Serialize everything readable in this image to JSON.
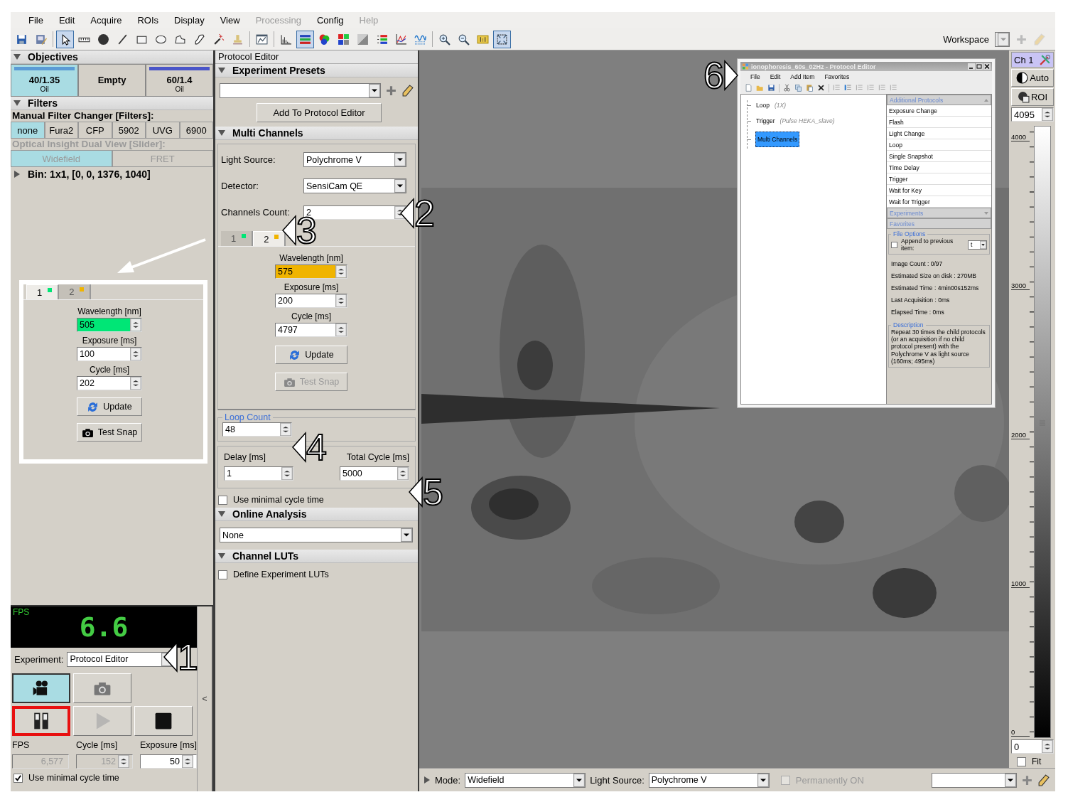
{
  "menu": [
    {
      "label": "File",
      "disabled": false
    },
    {
      "label": "Edit",
      "disabled": false
    },
    {
      "label": "Acquire",
      "disabled": false
    },
    {
      "label": "ROIs",
      "disabled": false
    },
    {
      "label": "Display",
      "disabled": false
    },
    {
      "label": "View",
      "disabled": false
    },
    {
      "label": "Processing",
      "disabled": true
    },
    {
      "label": "Config",
      "disabled": false
    },
    {
      "label": "Help",
      "disabled": true
    }
  ],
  "toolbar": {
    "tools": [
      {
        "kind": "save",
        "selected": false
      },
      {
        "kind": "save-image",
        "selected": false
      },
      {
        "kind": "pointer",
        "selected": true
      },
      {
        "kind": "ruler",
        "selected": false
      },
      {
        "kind": "dot",
        "selected": false
      },
      {
        "kind": "line",
        "selected": false
      },
      {
        "kind": "rectangle",
        "selected": false
      },
      {
        "kind": "ellipse",
        "selected": false
      },
      {
        "kind": "polygon",
        "selected": false
      },
      {
        "kind": "pen",
        "selected": false
      },
      {
        "kind": "wand",
        "selected": false
      },
      {
        "kind": "stamp",
        "selected": false
      },
      {
        "kind": "chart-window",
        "selected": false
      },
      {
        "kind": "histogram",
        "selected": false
      },
      {
        "kind": "color-bars",
        "selected": true
      },
      {
        "kind": "color-circles",
        "selected": false
      },
      {
        "kind": "color-grid",
        "selected": false
      },
      {
        "kind": "gradient",
        "selected": false
      },
      {
        "kind": "color-list",
        "selected": false
      },
      {
        "kind": "line-graph",
        "selected": false
      },
      {
        "kind": "wave",
        "selected": false
      },
      {
        "kind": "zoom-in",
        "selected": false
      },
      {
        "kind": "zoom-out",
        "selected": false
      },
      {
        "kind": "actual-size",
        "selected": false
      },
      {
        "kind": "fit-frame",
        "selected": true
      }
    ],
    "workspace_label": "Workspace"
  },
  "objectives": {
    "title": "Objectives",
    "expanded": true,
    "items": [
      {
        "label": "40/1.35",
        "sub": "Oil",
        "color": "#5b9bd5",
        "selected": true
      },
      {
        "label": "Empty",
        "selected": false
      },
      {
        "label": "60/1.4",
        "sub": "Oil",
        "color": "#4a55c8",
        "selected": false
      }
    ]
  },
  "filters": {
    "title": "Filters",
    "expanded": true,
    "changer_label": "Manual Filter Changer [Filters]:",
    "changer_items": [
      {
        "label": "none",
        "selected": true
      },
      {
        "label": "Fura2",
        "selected": false
      },
      {
        "label": "CFP",
        "selected": false
      },
      {
        "label": "5902",
        "selected": false
      },
      {
        "label": "UVG",
        "selected": false
      },
      {
        "label": "6900",
        "selected": false
      }
    ],
    "slider_label": "Optical Insight Dual View [Slider]:",
    "slider_disabled": true,
    "slider_items": [
      {
        "label": "Widefield",
        "selected": true
      },
      {
        "label": "FRET",
        "selected": false
      }
    ]
  },
  "bin": {
    "label": "Bin: 1x1, [0, 0, 1376, 1040]",
    "expanded": false
  },
  "channel_zoom": {
    "tabs": [
      {
        "label": "1",
        "color": "#00e676",
        "selected": true
      },
      {
        "label": "2",
        "color": "#f0b400",
        "selected": false
      }
    ],
    "fields": [
      {
        "kind": "wavelength",
        "label": "Wavelength [nm]",
        "value": "505"
      },
      {
        "kind": "number",
        "label": "Exposure [ms]",
        "value": "100"
      },
      {
        "kind": "number",
        "label": "Cycle [ms]",
        "value": "202"
      }
    ],
    "buttons": [
      {
        "kind": "update",
        "label": "Update",
        "disabled": false
      },
      {
        "kind": "snap",
        "label": "Test Snap",
        "disabled": false
      }
    ]
  },
  "acquisition": {
    "fps_label": "FPS",
    "fps_value": "6.6",
    "experiment_label": "Experiment:",
    "experiment_value": "Protocol Editor",
    "buttons": [
      {
        "kind": "video",
        "selected": true,
        "highlighted": false,
        "disabled": false
      },
      {
        "kind": "camera",
        "selected": false,
        "highlighted": false,
        "disabled": false
      },
      {
        "kind": "pause",
        "selected": false,
        "highlighted": true,
        "disabled": false
      },
      {
        "kind": "play",
        "selected": false,
        "highlighted": false,
        "disabled": true
      },
      {
        "kind": "stop",
        "selected": false,
        "highlighted": false,
        "disabled": false
      }
    ],
    "stats": [
      {
        "kind": "plain",
        "label": "FPS",
        "value": "6,577",
        "disabled": true
      },
      {
        "kind": "spin",
        "label": "Cycle [ms]",
        "value": "152",
        "disabled": true
      },
      {
        "kind": "spin",
        "label": "Exposure [ms]",
        "value": "50",
        "disabled": false
      }
    ],
    "minimal_cycle": {
      "label": "Use minimal cycle time",
      "checked": true
    },
    "collapse": "<"
  },
  "protocol_editor": {
    "title": "Protocol Editor",
    "presets": {
      "title": "Experiment Presets",
      "expanded": true,
      "add_button": "Add To Protocol Editor"
    },
    "multi_channels": {
      "title": "Multi Channels",
      "expanded": true,
      "light_source_label": "Light Source:",
      "light_source": "Polychrome V",
      "detector_label": "Detector:",
      "detector": "SensiCam QE",
      "count_label": "Channels Count:",
      "count": "2",
      "tabs": [
        {
          "label": "1",
          "color": "#00e676",
          "selected": false
        },
        {
          "label": "2",
          "color": "#f0b400",
          "selected": true
        }
      ],
      "fields": [
        {
          "kind": "wavelength",
          "label": "Wavelength [nm]",
          "value": "575"
        },
        {
          "kind": "number",
          "label": "Exposure [ms]",
          "value": "200"
        },
        {
          "kind": "number",
          "label": "Cycle [ms]",
          "value": "4797"
        }
      ],
      "buttons": [
        {
          "kind": "update",
          "label": "Update",
          "disabled": false
        },
        {
          "kind": "snap",
          "label": "Test Snap",
          "disabled": true
        }
      ]
    },
    "loop": {
      "title": "Loop Count",
      "value": "48"
    },
    "delay_label": "Delay [ms]",
    "delay": "1",
    "total_label": "Total Cycle [ms]",
    "total": "5000",
    "minimal_cycle": {
      "label": "Use minimal cycle time",
      "checked": false
    },
    "analysis": {
      "title": "Online Analysis",
      "expanded": true,
      "value": "None"
    },
    "luts": {
      "title": "Channel LUTs",
      "expanded": true,
      "checkbox": {
        "label": "Define Experiment LUTs",
        "checked": false
      }
    }
  },
  "inset_window": {
    "title": "ionophoresis_60s_02Hz - Protocol Editor",
    "menu": [
      "File",
      "Edit",
      "Add Item",
      "Favorites"
    ],
    "tools": [
      {
        "kind": "new-file"
      },
      {
        "kind": "folder"
      },
      {
        "kind": "save"
      },
      {
        "kind": "scissors"
      },
      {
        "kind": "copy"
      },
      {
        "kind": "paste"
      },
      {
        "kind": "delete"
      },
      {
        "kind": "list-lines"
      },
      {
        "kind": "list-marker"
      },
      {
        "kind": "list-lines"
      },
      {
        "kind": "list-lines"
      },
      {
        "kind": "list-lines"
      },
      {
        "kind": "list-lines"
      }
    ],
    "tree": [
      {
        "label": "Loop",
        "note": "(1X)",
        "selected": false
      },
      {
        "label": "Trigger",
        "note": "(Pulse HEKA_slave)",
        "selected": false
      },
      {
        "label": "Multi Channels",
        "selected": true
      }
    ],
    "additional_title": "Additional Protocols",
    "protocols": [
      "Exposure Change",
      "Flash",
      "Light Change",
      "Loop",
      "Single Snapshot",
      "Time Delay",
      "Trigger",
      "Wait for Key",
      "Wait for Trigger"
    ],
    "experiments_title": "Experiments",
    "favorites_title": "Favorites",
    "file_options": {
      "title": "File Options",
      "label": "Append to previous item:",
      "checked": false,
      "value": "t"
    },
    "stats": [
      "Image Count : 0/97",
      "Estimated Size on disk : 270MB",
      "Estimated Time : 4min00s152ms",
      "Last Acquisition : 0ms",
      "Elapsed Time : 0ms"
    ],
    "description_title": "Description",
    "description": "Repeat 30 times the child protocols (or an acquisition if no child protocol present) with the Polychrome V as light source (160ms; 495ms)"
  },
  "display_panel": {
    "channel": "Ch 1",
    "auto": "Auto",
    "roi": "ROI",
    "max": "4095",
    "scale": [
      "4000",
      "3000",
      "2000",
      "1000",
      "0"
    ],
    "min": "0",
    "fit": {
      "label": "Fit",
      "checked": false
    }
  },
  "status_bar": {
    "mode_label": "Mode:",
    "mode": "Widefield",
    "light_label": "Light Source:",
    "light": "Polychrome V",
    "permanent": {
      "label": "Permanently ON",
      "checked": false,
      "disabled": true
    }
  },
  "callouts": [
    {
      "label": "1"
    },
    {
      "label": "2"
    },
    {
      "label": "3"
    },
    {
      "label": "4"
    },
    {
      "label": "5"
    },
    {
      "label": "6"
    }
  ]
}
